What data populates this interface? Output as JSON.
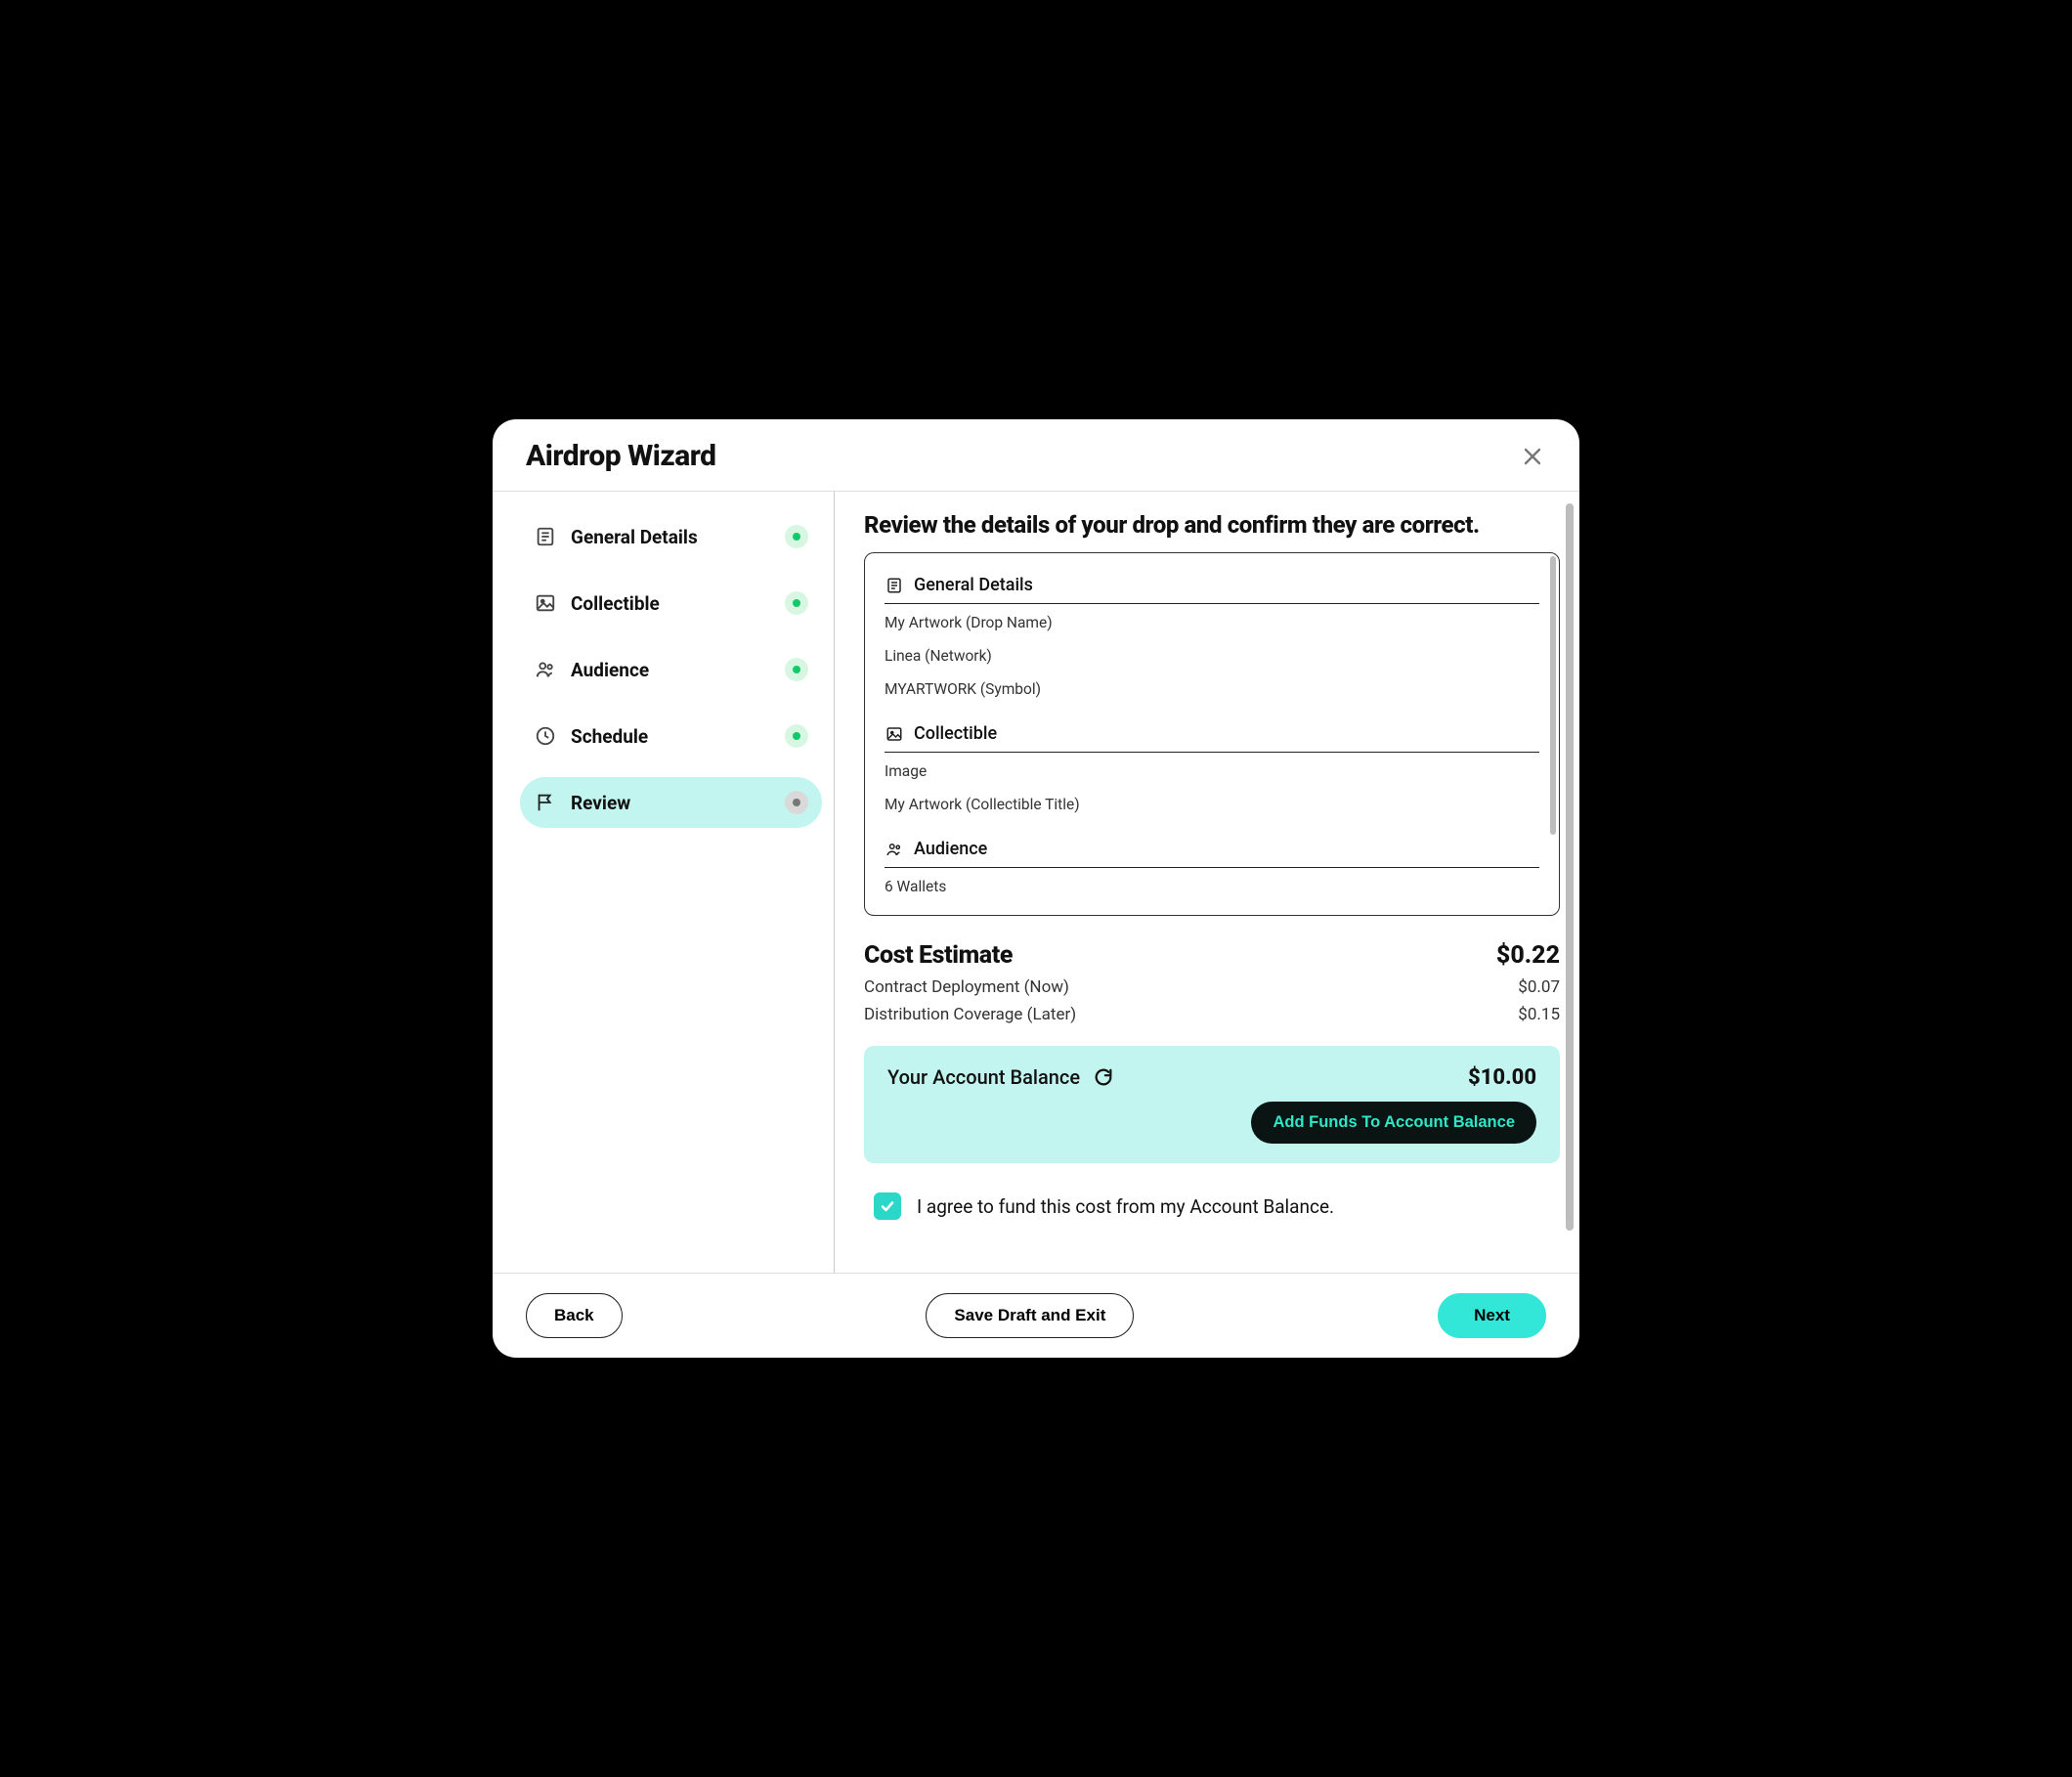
{
  "header": {
    "title": "Airdrop Wizard"
  },
  "sidebar": {
    "items": [
      {
        "label": "General Details",
        "status": "done",
        "icon": "document"
      },
      {
        "label": "Collectible",
        "status": "done",
        "icon": "image"
      },
      {
        "label": "Audience",
        "status": "done",
        "icon": "people"
      },
      {
        "label": "Schedule",
        "status": "done",
        "icon": "clock"
      },
      {
        "label": "Review",
        "status": "current",
        "icon": "flag"
      }
    ]
  },
  "review": {
    "heading": "Review the details of your drop and confirm they are correct.",
    "general": {
      "section_label": "General Details",
      "drop_name": "My Artwork (Drop Name)",
      "network": "Linea (Network)",
      "symbol": "MYARTWORK (Symbol)"
    },
    "collectible": {
      "section_label": "Collectible",
      "media_type": "Image",
      "title": "My Artwork (Collectible Title)"
    },
    "audience": {
      "section_label": "Audience",
      "wallets": "6 Wallets"
    }
  },
  "cost": {
    "label": "Cost Estimate",
    "total": "$0.22",
    "contract_label": "Contract Deployment (Now)",
    "contract_value": "$0.07",
    "distribution_label": "Distribution Coverage (Later)",
    "distribution_value": "$0.15"
  },
  "balance": {
    "label": "Your Account Balance",
    "amount": "$10.00",
    "add_funds_label": "Add Funds To Account Balance"
  },
  "agree": {
    "checked": true,
    "text": "I agree to fund this cost from my Account Balance."
  },
  "footer": {
    "back": "Back",
    "save": "Save Draft and Exit",
    "next": "Next"
  }
}
